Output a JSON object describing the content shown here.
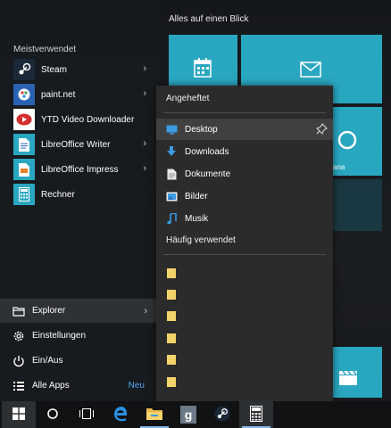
{
  "tiles": {
    "header": "Alles auf einen Blick",
    "partial_label": "ana"
  },
  "start": {
    "section": "Meistverwendet",
    "apps": [
      {
        "label": "Steam",
        "icon": "steam-icon",
        "has_submenu": true
      },
      {
        "label": "paint.net",
        "icon": "paintnet-icon",
        "has_submenu": true
      },
      {
        "label": "YTD Video Downloader",
        "icon": "ytd-icon",
        "has_submenu": false
      },
      {
        "label": "LibreOffice Writer",
        "icon": "writer-icon",
        "has_submenu": true
      },
      {
        "label": "LibreOffice Impress",
        "icon": "impress-icon",
        "has_submenu": true
      },
      {
        "label": "Rechner",
        "icon": "calculator-icon",
        "has_submenu": false
      }
    ],
    "system": [
      {
        "label": "Explorer",
        "icon": "explorer-icon"
      },
      {
        "label": "Einstellungen",
        "icon": "settings-icon"
      },
      {
        "label": "Ein/Aus",
        "icon": "power-icon"
      },
      {
        "label": "Alle Apps",
        "icon": "all-apps-icon",
        "badge": "Neu"
      }
    ]
  },
  "jumplist": {
    "pinned_header": "Angeheftet",
    "pinned": [
      {
        "label": "Desktop",
        "icon": "desktop-icon",
        "selected": true
      },
      {
        "label": "Downloads",
        "icon": "download-icon"
      },
      {
        "label": "Dokumente",
        "icon": "documents-icon"
      },
      {
        "label": "Bilder",
        "icon": "pictures-icon"
      },
      {
        "label": "Musik",
        "icon": "music-icon"
      }
    ],
    "frequent_header": "Häufig verwendet"
  },
  "taskbar": {
    "items": [
      "start",
      "search",
      "task-view",
      "edge",
      "file-explorer",
      "gimp",
      "steam",
      "calculator"
    ],
    "active": "calculator"
  },
  "colors": {
    "accent": "#2aa7c0",
    "highlight": "#404040",
    "new_badge": "#4fa4f0"
  }
}
